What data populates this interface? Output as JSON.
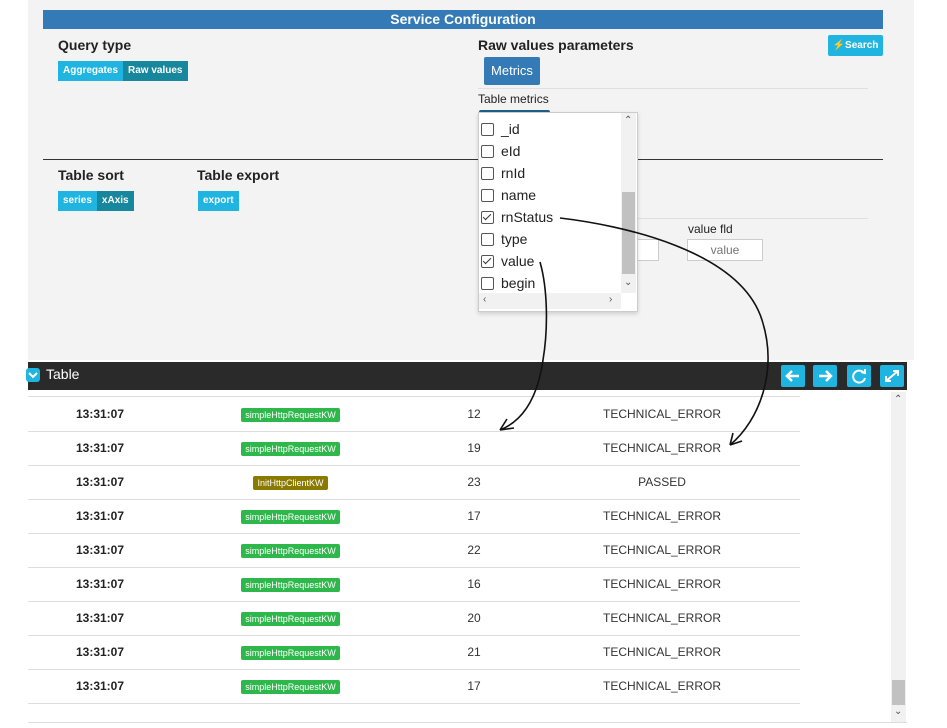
{
  "config": {
    "header_title": "Service Configuration",
    "query_type": {
      "title": "Query type",
      "buttons": [
        "Aggregates",
        "Raw values"
      ]
    },
    "raw_values": {
      "title": "Raw values parameters",
      "metrics_button": "Metrics",
      "table_metrics_label": "Table metrics"
    },
    "search_button": "Search",
    "table_sort": {
      "title": "Table sort",
      "buttons": [
        "series",
        "xAxis"
      ]
    },
    "table_export": {
      "title": "Table export",
      "button": "export"
    },
    "value_fld": {
      "label": "value fld",
      "placeholder": "value"
    }
  },
  "dropdown": {
    "options": [
      {
        "label": "_id",
        "checked": false
      },
      {
        "label": "eId",
        "checked": false
      },
      {
        "label": "rnId",
        "checked": false
      },
      {
        "label": "name",
        "checked": false
      },
      {
        "label": "rnStatus",
        "checked": true
      },
      {
        "label": "type",
        "checked": false
      },
      {
        "label": "value",
        "checked": true
      },
      {
        "label": "begin",
        "checked": false
      }
    ]
  },
  "table": {
    "title": "Table",
    "rows": [
      {
        "time": "13:31:07",
        "keyword": "simpleHttpRequestKW",
        "value": "12",
        "status": "TECHNICAL_ERROR"
      },
      {
        "time": "13:31:07",
        "keyword": "simpleHttpRequestKW",
        "value": "19",
        "status": "TECHNICAL_ERROR"
      },
      {
        "time": "13:31:07",
        "keyword": "InitHttpClientKW",
        "value": "23",
        "status": "PASSED"
      },
      {
        "time": "13:31:07",
        "keyword": "simpleHttpRequestKW",
        "value": "17",
        "status": "TECHNICAL_ERROR"
      },
      {
        "time": "13:31:07",
        "keyword": "simpleHttpRequestKW",
        "value": "22",
        "status": "TECHNICAL_ERROR"
      },
      {
        "time": "13:31:07",
        "keyword": "simpleHttpRequestKW",
        "value": "16",
        "status": "TECHNICAL_ERROR"
      },
      {
        "time": "13:31:07",
        "keyword": "simpleHttpRequestKW",
        "value": "20",
        "status": "TECHNICAL_ERROR"
      },
      {
        "time": "13:31:07",
        "keyword": "simpleHttpRequestKW",
        "value": "21",
        "status": "TECHNICAL_ERROR"
      },
      {
        "time": "13:31:07",
        "keyword": "simpleHttpRequestKW",
        "value": "17",
        "status": "TECHNICAL_ERROR"
      }
    ],
    "toolbar_icons": [
      "arrow-left-icon",
      "arrow-right-icon",
      "refresh-icon",
      "expand-icon"
    ]
  },
  "colors": {
    "header_blue": "#337ab7",
    "button_cyan": "#1fb5e0",
    "button_teal": "#16879d",
    "badge_green": "#2eb84b",
    "badge_olive": "#8a7a00",
    "table_bar": "#2a2a2a"
  }
}
